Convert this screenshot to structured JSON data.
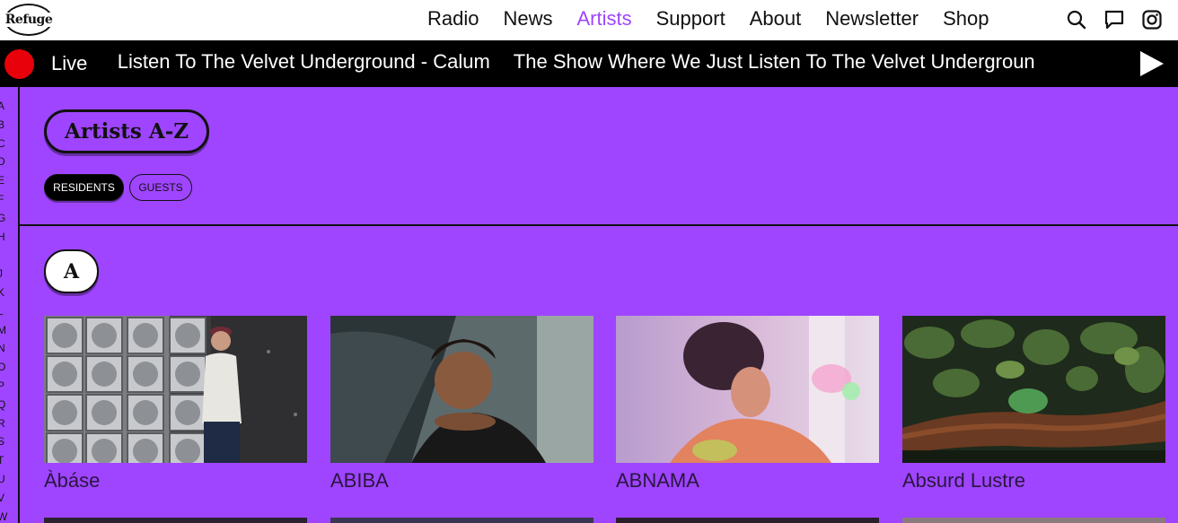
{
  "logo": {
    "text": "Refuge"
  },
  "nav": {
    "items": [
      "Radio",
      "News",
      "Artists",
      "Support",
      "About",
      "Newsletter",
      "Shop"
    ],
    "active": "Artists"
  },
  "icons": [
    "search-icon",
    "chat-icon",
    "instagram-icon"
  ],
  "live": {
    "label": "Live",
    "ticker": [
      "e Just Listen To The Velvet Underground - Calum",
      "The Show Where We Just Listen To The Velvet Undergroun"
    ]
  },
  "alphabet": [
    "A",
    "B",
    "C",
    "D",
    "E",
    "F",
    "G",
    "H",
    "I",
    "J",
    "K",
    "L",
    "M",
    "N",
    "O",
    "P",
    "Q",
    "R",
    "S",
    "T",
    "U",
    "V",
    "W"
  ],
  "page": {
    "title": "Artists A-Z"
  },
  "filters": {
    "residents": "RESIDENTS",
    "guests": "GUESTS",
    "selected": "RESIDENTS"
  },
  "section": {
    "letter": "A"
  },
  "artists": [
    "Àbáse",
    "ABIBA",
    "ABNAMA",
    "Absurd Lustre"
  ],
  "colors": {
    "accent": "#9f45ff",
    "live": "#e8000b"
  }
}
